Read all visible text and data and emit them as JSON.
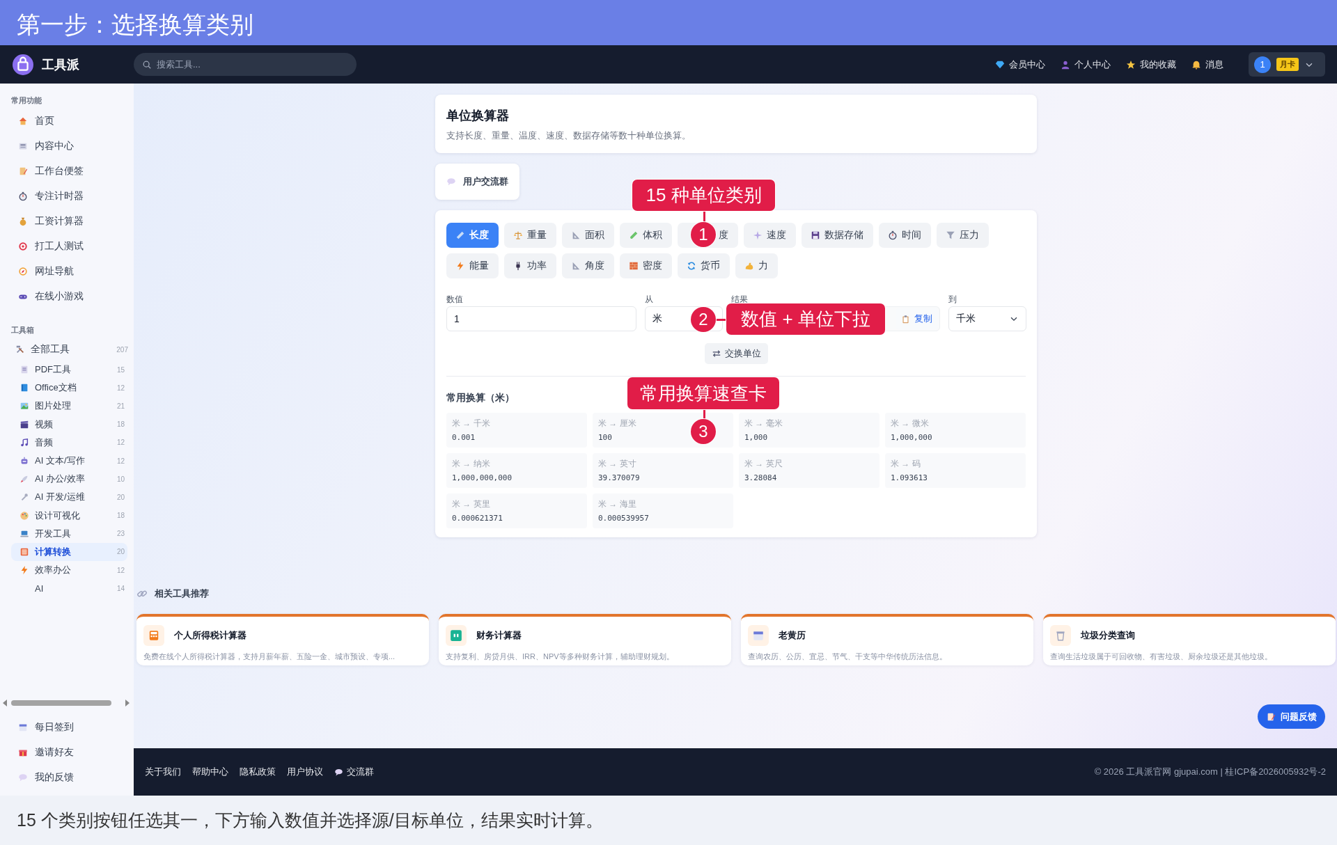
{
  "banner": {
    "title": "第一步：选择换算类别"
  },
  "navbar": {
    "brand": "工具派",
    "search": {
      "placeholder": "搜索工具..."
    },
    "links": [
      "会员中心",
      "个人中心",
      "我的收藏",
      "消息"
    ],
    "user": {
      "avatar": "1",
      "badge": "月卡"
    }
  },
  "sidebar": {
    "sections": [
      {
        "title": "常用功能",
        "items": [
          {
            "label": "首页",
            "selected": false
          },
          {
            "label": "内容中心",
            "selected": false
          },
          {
            "label": "工作台便签",
            "selected": false
          },
          {
            "label": "专注计时器",
            "selected": false
          },
          {
            "label": "工资计算器",
            "selected": false
          },
          {
            "label": "打工人测试",
            "selected": false
          },
          {
            "label": "网址导航",
            "selected": false
          },
          {
            "label": "在线小游戏",
            "selected": false
          }
        ]
      },
      {
        "title": "工具箱",
        "items": [
          {
            "label": "全部工具",
            "count": "207",
            "selected": false,
            "children": [
              {
                "label": "PDF工具",
                "count": "15",
                "selected": false
              },
              {
                "label": "Office文档",
                "count": "12",
                "selected": false
              },
              {
                "label": "图片处理",
                "count": "21",
                "selected": false
              },
              {
                "label": "视频",
                "count": "18",
                "selected": false
              },
              {
                "label": "音频",
                "count": "12",
                "selected": false
              },
              {
                "label": "AI 文本/写作",
                "count": "12",
                "selected": false
              },
              {
                "label": "AI 办公/效率",
                "count": "10",
                "selected": false
              },
              {
                "label": "AI 开发/运维",
                "count": "20",
                "selected": false
              },
              {
                "label": "设计可视化",
                "count": "18",
                "selected": false
              },
              {
                "label": "开发工具",
                "count": "23",
                "selected": false
              },
              {
                "label": "计算转换",
                "count": "20",
                "selected": true
              },
              {
                "label": "效率办公",
                "count": "12",
                "selected": false
              },
              {
                "label": "AI",
                "count": "14",
                "selected": false
              }
            ]
          }
        ]
      }
    ],
    "bottom_items": [
      {
        "label": "每日签到",
        "selected": false
      },
      {
        "label": "邀请好友",
        "selected": false
      },
      {
        "label": "我的反馈",
        "selected": false
      }
    ]
  },
  "header_card": {
    "title": "单位换算器",
    "subtitle": "支持长度、重量、温度、速度、数据存储等数十种单位换算。"
  },
  "community_button": {
    "label": "用户交流群"
  },
  "converter": {
    "categories": [
      {
        "label": "长度",
        "selected": true
      },
      {
        "label": "重量",
        "selected": false
      },
      {
        "label": "面积",
        "selected": false
      },
      {
        "label": "体积",
        "selected": false
      },
      {
        "label": "度",
        "selected": false
      },
      {
        "label": "速度",
        "selected": false
      },
      {
        "label": "数据存储",
        "selected": false
      },
      {
        "label": "时间",
        "selected": false
      },
      {
        "label": "压力",
        "selected": false
      },
      {
        "label": "能量",
        "selected": false
      },
      {
        "label": "功率",
        "selected": false
      },
      {
        "label": "角度",
        "selected": false
      },
      {
        "label": "密度",
        "selected": false
      },
      {
        "label": "货币",
        "selected": false
      },
      {
        "label": "力",
        "selected": false
      }
    ],
    "value": {
      "label": "数值",
      "value": "1"
    },
    "from": {
      "label": "从",
      "value": "米"
    },
    "result": {
      "label": "结果",
      "copy": "复制"
    },
    "to": {
      "label": "到",
      "value": "千米"
    },
    "swap": "交换单位",
    "quick": {
      "title": "常用换算（米）",
      "items": [
        {
          "label": "米 → 千米",
          "value": "0.001"
        },
        {
          "label": "米 → 厘米",
          "value": "100"
        },
        {
          "label": "米 → 毫米",
          "value": "1,000"
        },
        {
          "label": "米 → 微米",
          "value": "1,000,000"
        },
        {
          "label": "米 → 纳米",
          "value": "1,000,000,000"
        },
        {
          "label": "米 → 英寸",
          "value": "39.370079"
        },
        {
          "label": "米 → 英尺",
          "value": "3.28084"
        },
        {
          "label": "米 → 码",
          "value": "1.093613"
        },
        {
          "label": "米 → 英里",
          "value": "0.000621371"
        },
        {
          "label": "米 → 海里",
          "value": "0.000539957"
        }
      ]
    }
  },
  "annotations": [
    {
      "label": "15 种单位类别",
      "number": "1"
    },
    {
      "label": "数值 + 单位下拉",
      "number": "2"
    },
    {
      "label": "常用换算速查卡",
      "number": "3"
    }
  ],
  "related": {
    "title": "相关工具推荐",
    "cards": [
      {
        "title": "个人所得税计算器",
        "description": "免费在线个人所得税计算器，支持月薪年薪、五险一金、城市预设、专项..."
      },
      {
        "title": "财务计算器",
        "description": "支持复利、房贷月供、IRR、NPV等多种财务计算，辅助理财规划。"
      },
      {
        "title": "老黄历",
        "description": "查询农历、公历、宜忌、节气、干支等中华传统历法信息。"
      },
      {
        "title": "垃圾分类查询",
        "description": "查询生活垃圾属于可回收物、有害垃圾、厨余垃圾还是其他垃圾。"
      }
    ]
  },
  "feedback_button": "问题反馈",
  "footer": {
    "links": [
      "关于我们",
      "帮助中心",
      "隐私政策",
      "用户协议",
      "交流群"
    ],
    "copyright": "© 2026 工具派官网 gjupai.com | 桂ICP备2026005932号-2"
  },
  "caption": "15 个类别按钮任选其一，下方输入数值并选择源/目标单位，结果实时计算。"
}
